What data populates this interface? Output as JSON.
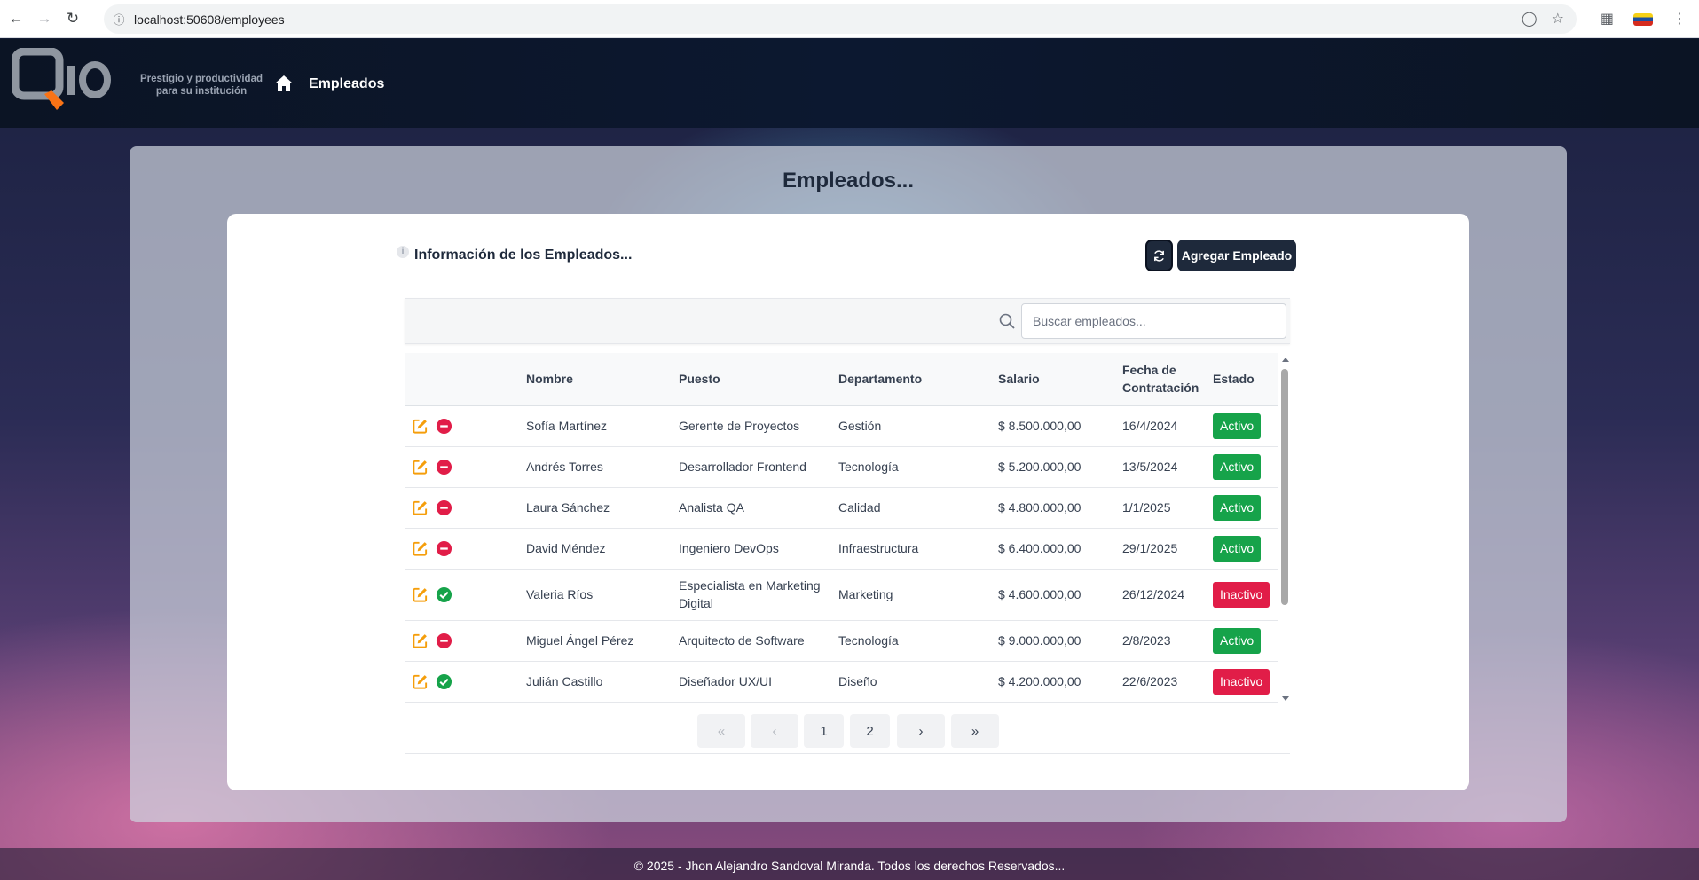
{
  "browser": {
    "url": "localhost:50608/employees"
  },
  "header": {
    "tagline_line1": "Prestigio y productividad",
    "tagline_line2": "para su institución",
    "nav_title": "Empleados"
  },
  "panel": {
    "title": "Empleados..."
  },
  "card": {
    "title": "Información de los Empleados...",
    "info_glyph": "i",
    "add_button_label": "Agregar Empleado"
  },
  "search": {
    "placeholder": "Buscar empleados..."
  },
  "table": {
    "columns": {
      "nombre": "Nombre",
      "puesto": "Puesto",
      "departamento": "Departamento",
      "salario": "Salario",
      "fecha_line1": "Fecha de",
      "fecha_line2": "Contratación",
      "estado": "Estado"
    },
    "rows": [
      {
        "nombre": "Sofía Martínez",
        "puesto": "Gerente de Proyectos",
        "departamento": "Gestión",
        "salario": "$ 8.500.000,00",
        "fecha": "16/4/2024",
        "estado": "Activo"
      },
      {
        "nombre": "Andrés Torres",
        "puesto": "Desarrollador Frontend",
        "departamento": "Tecnología",
        "salario": "$ 5.200.000,00",
        "fecha": "13/5/2024",
        "estado": "Activo"
      },
      {
        "nombre": "Laura Sánchez",
        "puesto": "Analista QA",
        "departamento": "Calidad",
        "salario": "$ 4.800.000,00",
        "fecha": "1/1/2025",
        "estado": "Activo"
      },
      {
        "nombre": "David Méndez",
        "puesto": "Ingeniero DevOps",
        "departamento": "Infraestructura",
        "salario": "$ 6.400.000,00",
        "fecha": "29/1/2025",
        "estado": "Activo"
      },
      {
        "nombre": "Valeria Ríos",
        "puesto": "Especialista en Marketing Digital",
        "departamento": "Marketing",
        "salario": "$ 4.600.000,00",
        "fecha": "26/12/2024",
        "estado": "Inactivo"
      },
      {
        "nombre": "Miguel Ángel Pérez",
        "puesto": "Arquitecto de Software",
        "departamento": "Tecnología",
        "salario": "$ 9.000.000,00",
        "fecha": "2/8/2023",
        "estado": "Activo"
      },
      {
        "nombre": "Julián Castillo",
        "puesto": "Diseñador UX/UI",
        "departamento": "Diseño",
        "salario": "$ 4.200.000,00",
        "fecha": "22/6/2023",
        "estado": "Inactivo"
      }
    ]
  },
  "pagination": {
    "first": "«",
    "prev": "‹",
    "pages": [
      "1",
      "2"
    ],
    "next": "›",
    "last": "»"
  },
  "footer": {
    "text": "© 2025 - Jhon Alejandro Sandoval Miranda. Todos los derechos Reservados..."
  },
  "colors": {
    "navy": "#1e293b",
    "active": "#16a34a",
    "inactive": "#e11d48",
    "edit": "#f59e0b"
  },
  "icons": {
    "edit": "edit-icon",
    "deactivate": "minus-circle-icon",
    "activate": "check-circle-icon",
    "refresh": "refresh-icon",
    "search": "search-icon",
    "home": "home-icon"
  }
}
